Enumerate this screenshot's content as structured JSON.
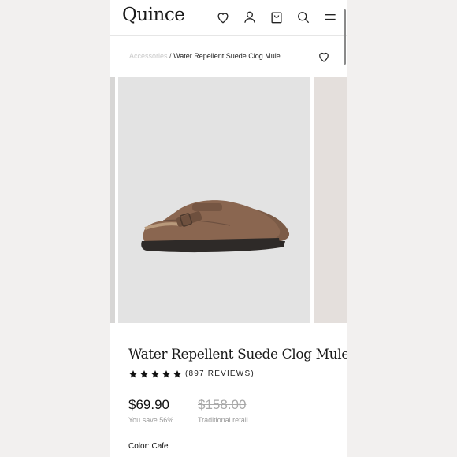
{
  "header": {
    "logo": "Quince",
    "icons": [
      "heart-icon",
      "account-icon",
      "bag-icon",
      "search-icon",
      "menu-icon"
    ]
  },
  "breadcrumb": {
    "link": "Accessories",
    "separator": "/",
    "current": "Water Repellent Suede Clog Mule"
  },
  "product": {
    "title": "Water Repellent Suede Clog Mule",
    "rating_stars": 5,
    "reviews": {
      "open": "(",
      "text": "897 REVIEWS",
      "close": ")"
    },
    "price": "$69.90",
    "savings": "You save 56%",
    "original_price": "$158.00",
    "original_label": "Traditional retail",
    "color_label": "Color:",
    "color_value": "Cafe"
  },
  "colors": {
    "accent": "#1a1a1a",
    "muted": "#9a9a9a",
    "shoe": "#7a5a45"
  }
}
